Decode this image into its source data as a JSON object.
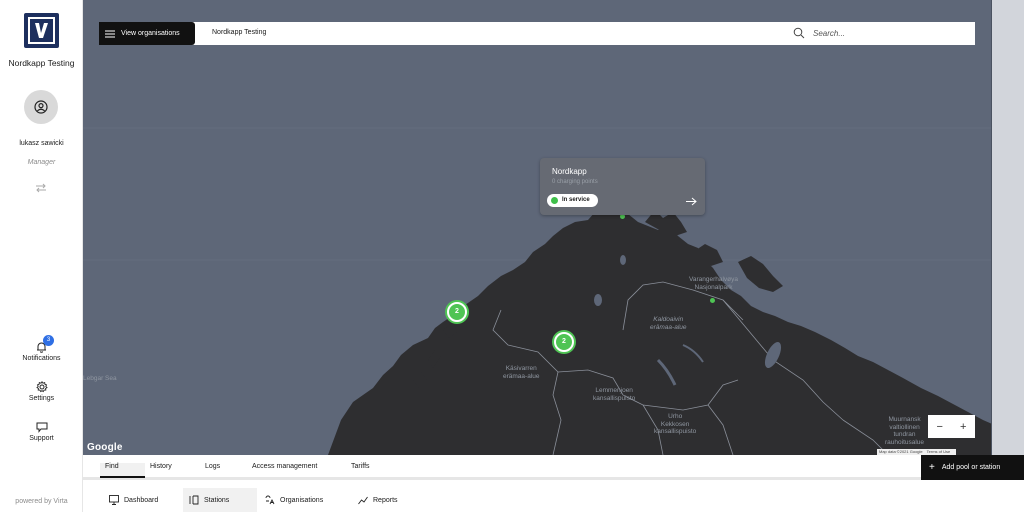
{
  "sidebar": {
    "org_name": "Nordkapp Testing",
    "user_name": "lukasz sawicki",
    "user_role": "Manager",
    "notifications_label": "Notifications",
    "notifications_count": "3",
    "settings_label": "Settings",
    "support_label": "Support",
    "powered_by": "powered by Virta"
  },
  "topbar": {
    "view_orgs_label": "View organisations",
    "breadcrumb": "Nordkapp Testing",
    "search_placeholder": "Search..."
  },
  "popup": {
    "title": "Nordkapp",
    "subtitle": "0 charging points",
    "status": "In service"
  },
  "map": {
    "clusters": [
      {
        "count": "2"
      },
      {
        "count": "2"
      }
    ],
    "places": [
      {
        "name": "Varangerhalvøya Nasjonalpark",
        "lines": [
          "Varangerhalvøya",
          "Nasjonalpark"
        ]
      },
      {
        "name": "Kaldoaivin erämaa-alue",
        "lines": [
          "Kaldoaivin",
          "erämaa-alue"
        ]
      },
      {
        "name": "Käsivarren erämaa-alue",
        "lines": [
          "Käsivarren",
          "erämaa-alue"
        ]
      },
      {
        "name": "Lemmenjoen kansallispuisto",
        "lines": [
          "Lemmenjoen",
          "kansallispuisto"
        ]
      },
      {
        "name": "Urho Kekkosen kansallispuisto",
        "lines": [
          "Urho",
          "Kekkosen",
          "kansallispuisto"
        ]
      },
      {
        "name": "Muurnansk valtiollinen tundran rauhoitusalue",
        "lines": [
          "Muurnansk",
          "valtiollinen",
          "tundran",
          "rauhoitusalue"
        ]
      },
      {
        "name": "Lebgar Sea",
        "lines": [
          "Lebgar Sea"
        ]
      }
    ],
    "google_label": "Google",
    "map_data": "Map data ©2021 Google",
    "terms": "Terms of Use",
    "zoom_out": "−",
    "zoom_in": "+",
    "land_color": "#2e2e30",
    "water_color": "#5e6778"
  },
  "tabs": {
    "items": [
      "Find",
      "History",
      "Logs",
      "Access management",
      "Tariffs"
    ],
    "active": "Find",
    "add_button": "Add pool or station"
  },
  "bottom_nav": {
    "items": [
      "Dashboard",
      "Stations",
      "Organisations",
      "Reports"
    ],
    "active": "Stations"
  },
  "colors": {
    "accent_green": "#4fc454",
    "badge_blue": "#2f6fe4",
    "logo_navy": "#1d2f5e"
  }
}
